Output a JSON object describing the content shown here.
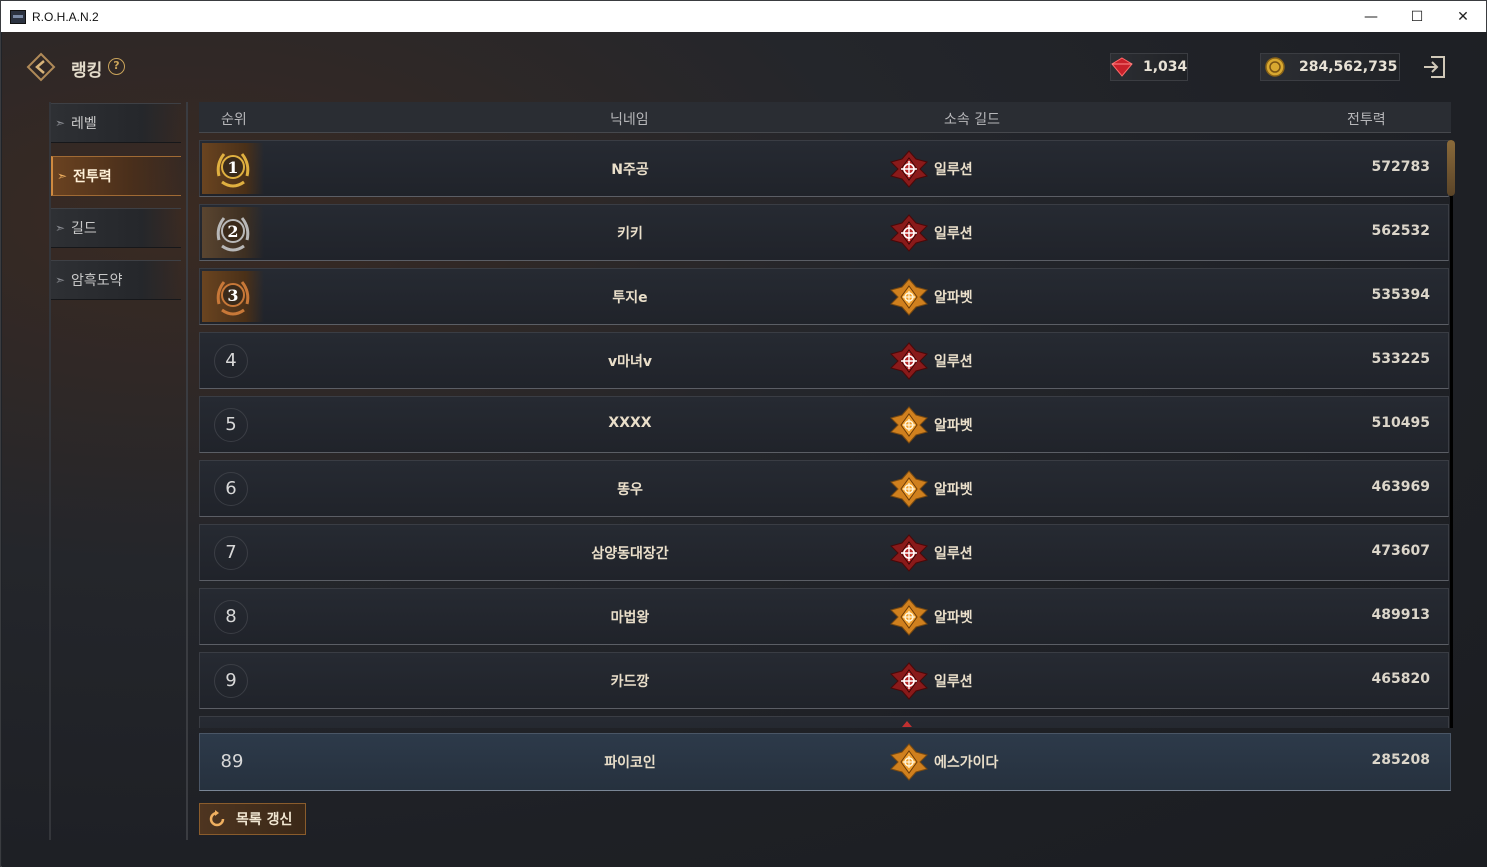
{
  "window": {
    "title": "R.O.H.A.N.2",
    "minimize": "—",
    "maximize": "☐",
    "close": "✕"
  },
  "header": {
    "title": "랭킹",
    "help": "?"
  },
  "currency": {
    "ruby": "1,034",
    "gold": "284,562,735"
  },
  "sidebar": {
    "items": [
      {
        "label": "레벨",
        "active": false
      },
      {
        "label": "전투력",
        "active": true
      },
      {
        "label": "길드",
        "active": false
      },
      {
        "label": "암흑도약",
        "active": false
      }
    ]
  },
  "table": {
    "columns": {
      "rank": "순위",
      "nickname": "닉네임",
      "guild": "소속 길드",
      "power": "전투력"
    },
    "rows": [
      {
        "rank": "1",
        "nickname": "N주공",
        "guild": "일루션",
        "guild_type": "red",
        "power": "572783"
      },
      {
        "rank": "2",
        "nickname": "키키",
        "guild": "일루션",
        "guild_type": "red",
        "power": "562532"
      },
      {
        "rank": "3",
        "nickname": "투지e",
        "guild": "알파벳",
        "guild_type": "orange",
        "power": "535394"
      },
      {
        "rank": "4",
        "nickname": "v마녀v",
        "guild": "일루션",
        "guild_type": "red",
        "power": "533225"
      },
      {
        "rank": "5",
        "nickname": "XXXX",
        "guild": "알파벳",
        "guild_type": "orange",
        "power": "510495"
      },
      {
        "rank": "6",
        "nickname": "똥우",
        "guild": "알파벳",
        "guild_type": "orange",
        "power": "463969"
      },
      {
        "rank": "7",
        "nickname": "삼양동대장간",
        "guild": "일루션",
        "guild_type": "red",
        "power": "473607"
      },
      {
        "rank": "8",
        "nickname": "마법왕",
        "guild": "알파벳",
        "guild_type": "orange",
        "power": "489913"
      },
      {
        "rank": "9",
        "nickname": "카드깡",
        "guild": "일루션",
        "guild_type": "red",
        "power": "465820"
      }
    ],
    "my_row": {
      "rank": "89",
      "nickname": "파이코인",
      "guild": "에스가이다",
      "guild_type": "orange",
      "power": "285208"
    }
  },
  "refresh_button": {
    "label": "목록 갱신"
  },
  "colors": {
    "gold_accent": "#c9a35a",
    "active_tab": "#6a4220",
    "guild_red": "#8a1a1a",
    "guild_orange": "#d0801e"
  }
}
